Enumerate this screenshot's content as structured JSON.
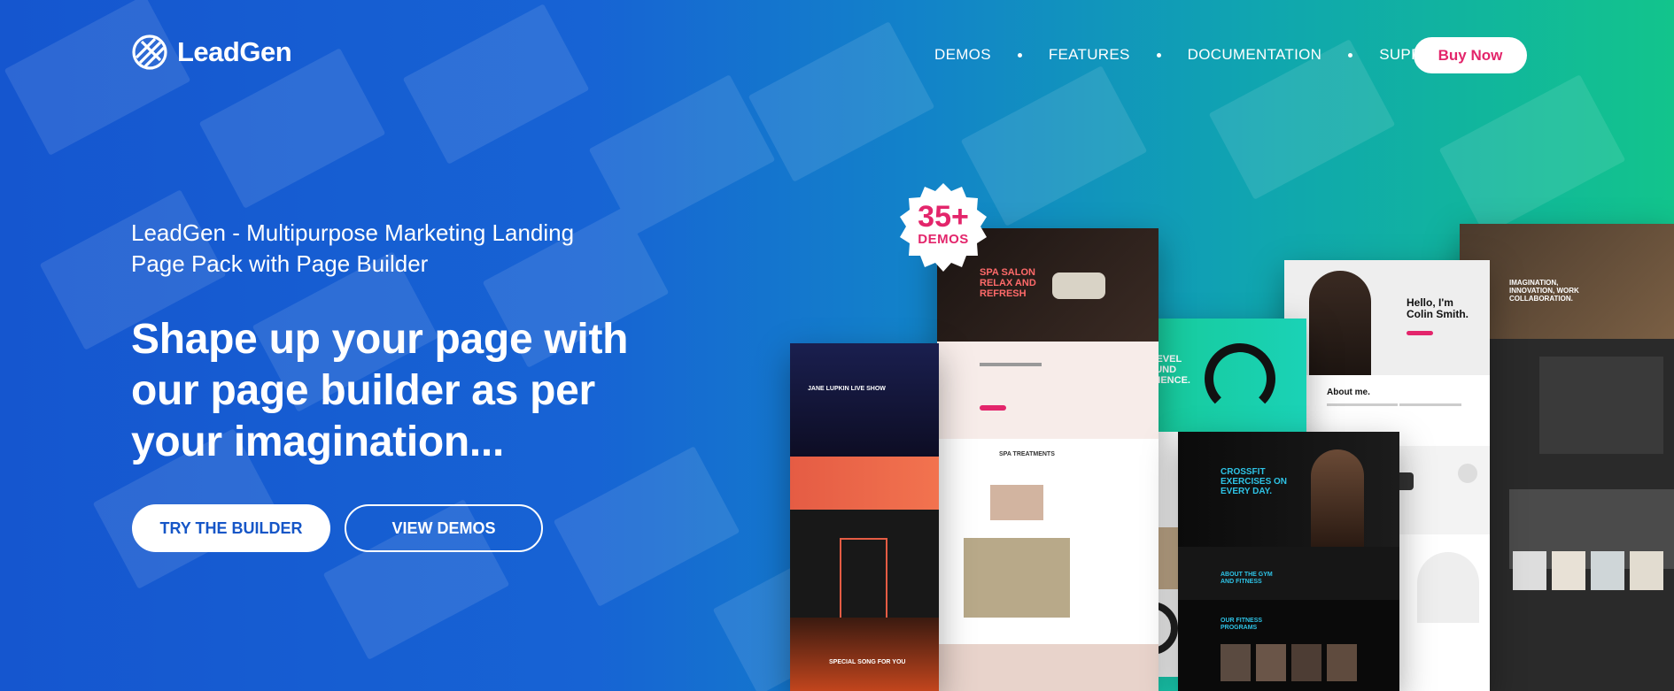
{
  "brand": {
    "name": "LeadGen",
    "logo_icon": "globe-stripes-icon"
  },
  "nav": {
    "items": [
      "DEMOS",
      "FEATURES",
      "DOCUMENTATION",
      "SUPPORT"
    ],
    "buy_label": "Buy Now"
  },
  "hero": {
    "subtitle_line1": "LeadGen - Multipurpose Marketing Landing",
    "subtitle_line2": "Page Pack with Page Builder",
    "headline_line1": "Shape up your page with",
    "headline_line2": "our page builder as per",
    "headline_line3": "your imagination...",
    "try_label": "TRY THE BUILDER",
    "view_label": "VIEW DEMOS"
  },
  "badge": {
    "count": "35+",
    "label": "DEMOS"
  },
  "demos": {
    "spa_title": "SPA SALON\nRELAX AND\nREFRESH",
    "sound_title": "NEW LEVEL\nOF SOUND\nEXPERIENCE.",
    "portfolio_title": "Hello, I'm\nColin Smith.",
    "about_label": "About me.",
    "crossfit_title": "CROSSFIT\nEXERCISES ON\nEVERY DAY.",
    "gym_label": "ABOUT THE GYM\nAND FITNESS",
    "programs_label": "OUR FITNESS\nPROGRAMS",
    "concert_title": "JANE LUPKIN LIVE SHOW",
    "song_label": "SPECIAL SONG FOR YOU",
    "spa_treatments": "SPA TREATMENTS",
    "interior_title": "IMAGINATION,\nINNOVATION, WORK\nCOLLABORATION."
  },
  "colors": {
    "accent_pink": "#e3256b",
    "brand_blue": "#1656c7",
    "gradient_start": "#1556cf",
    "gradient_end": "#12c48c"
  }
}
